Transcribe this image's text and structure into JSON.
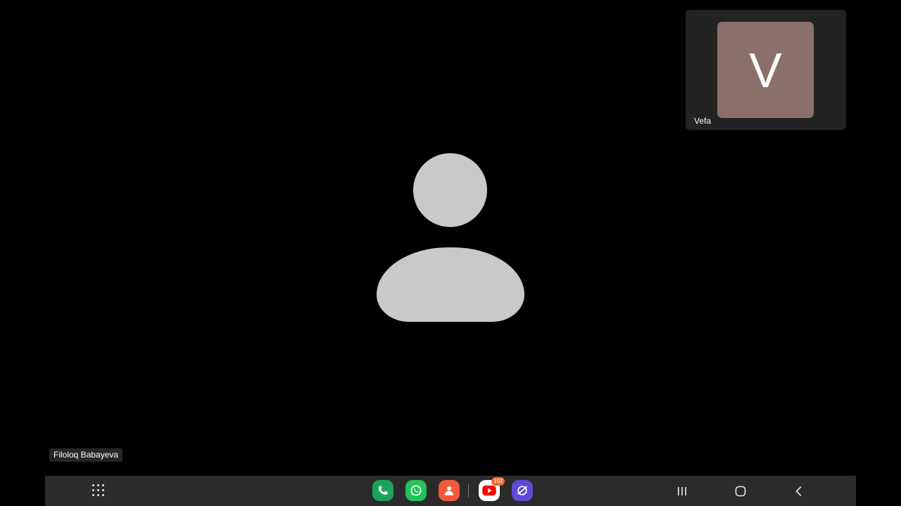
{
  "main_participant": {
    "name": "Filoloq Babayeva",
    "avatar_icon": "person-placeholder-icon"
  },
  "self_view": {
    "name": "Vefa",
    "initial": "V",
    "avatar_color": "#8a7068"
  },
  "taskbar": {
    "apps_icon": "apps-grid-icon",
    "dock": [
      {
        "name": "phone",
        "icon": "phone-icon"
      },
      {
        "name": "whatsapp",
        "icon": "whatsapp-icon"
      },
      {
        "name": "contacts",
        "icon": "contacts-icon"
      },
      {
        "name": "youtube",
        "icon": "youtube-icon",
        "badge": "192"
      },
      {
        "name": "internet",
        "icon": "internet-browser-icon"
      }
    ],
    "nav": [
      "recents-icon",
      "home-icon",
      "back-icon"
    ]
  },
  "colors": {
    "background": "#000000",
    "placeholder": "#cac9ca",
    "tile": "#232323",
    "taskbar": "#2b2b2b"
  }
}
